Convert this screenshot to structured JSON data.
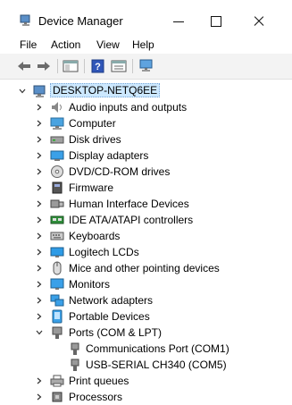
{
  "window": {
    "title": "Device Manager"
  },
  "menu": {
    "file": "File",
    "action": "Action",
    "view": "View",
    "help": "Help"
  },
  "tree": {
    "root": "DESKTOP-NETQ6EE",
    "items": [
      "Audio inputs and outputs",
      "Computer",
      "Disk drives",
      "Display adapters",
      "DVD/CD-ROM drives",
      "Firmware",
      "Human Interface Devices",
      "IDE ATA/ATAPI controllers",
      "Keyboards",
      "Logitech LCDs",
      "Mice and other pointing devices",
      "Monitors",
      "Network adapters",
      "Portable Devices",
      "Ports (COM & LPT)",
      "Print queues",
      "Processors"
    ],
    "ports_children": [
      "Communications Port (COM1)",
      "USB-SERIAL CH340 (COM5)"
    ]
  }
}
